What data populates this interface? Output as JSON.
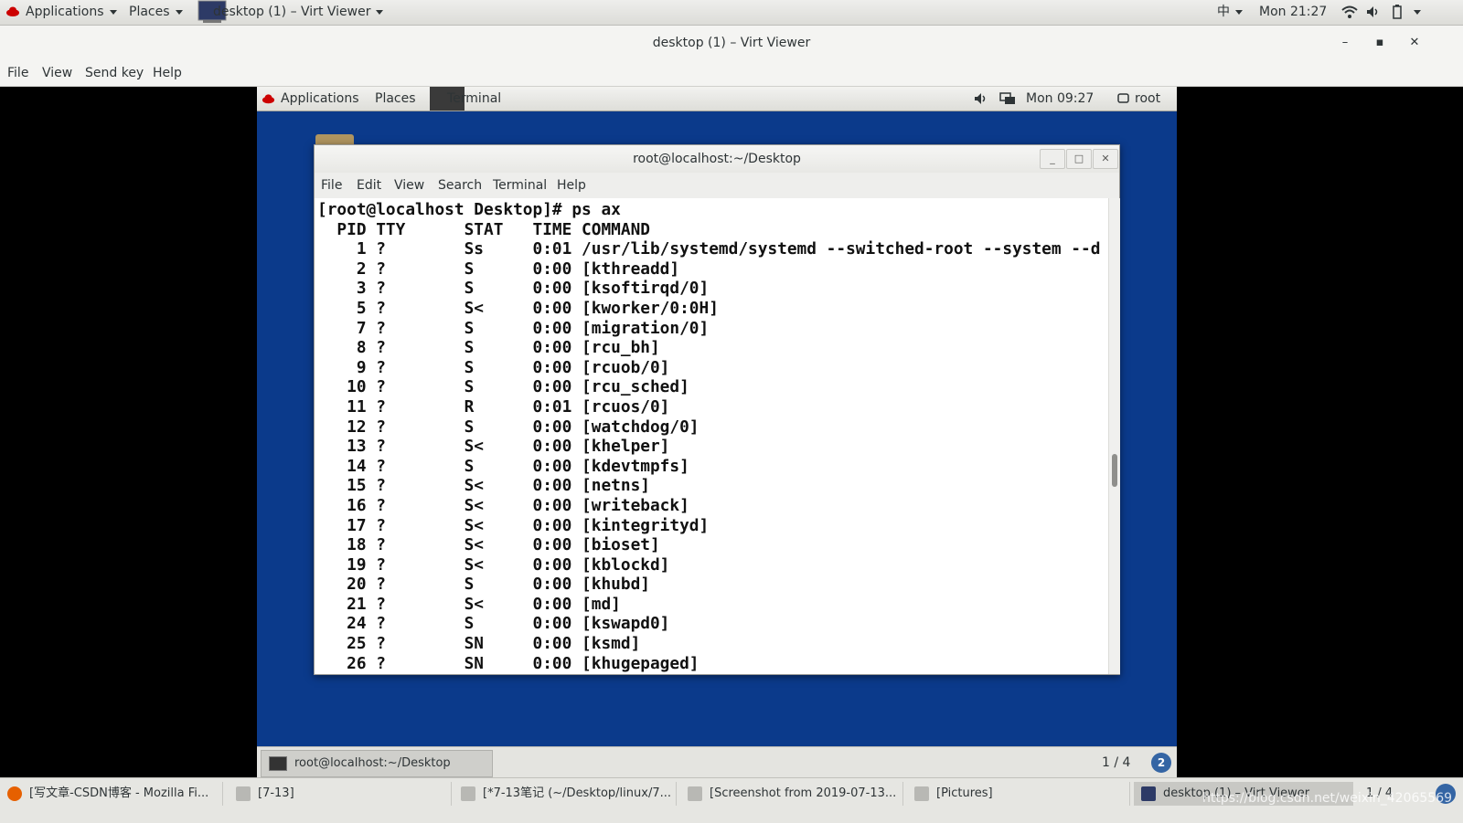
{
  "host_panel": {
    "applications": "Applications",
    "places": "Places",
    "window_title": "desktop (1) – Virt Viewer",
    "input_method": "中",
    "clock": "Mon 21:27"
  },
  "virt_viewer": {
    "title": "desktop (1) – Virt Viewer",
    "menu": [
      "File",
      "View",
      "Send key",
      "Help"
    ]
  },
  "guest_panel": {
    "applications": "Applications",
    "places": "Places",
    "terminal": "Terminal",
    "clock": "Mon 09:27",
    "user": "root"
  },
  "terminal": {
    "title": "root@localhost:~/Desktop",
    "menu": [
      "File",
      "Edit",
      "View",
      "Search",
      "Terminal",
      "Help"
    ],
    "output": "[root@localhost Desktop]# ps ax\n  PID TTY      STAT   TIME COMMAND\n    1 ?        Ss     0:01 /usr/lib/systemd/systemd --switched-root --system --d\n    2 ?        S      0:00 [kthreadd]\n    3 ?        S      0:00 [ksoftirqd/0]\n    5 ?        S<     0:00 [kworker/0:0H]\n    7 ?        S      0:00 [migration/0]\n    8 ?        S      0:00 [rcu_bh]\n    9 ?        S      0:00 [rcuob/0]\n   10 ?        S      0:00 [rcu_sched]\n   11 ?        R      0:01 [rcuos/0]\n   12 ?        S      0:00 [watchdog/0]\n   13 ?        S<     0:00 [khelper]\n   14 ?        S      0:00 [kdevtmpfs]\n   15 ?        S<     0:00 [netns]\n   16 ?        S<     0:00 [writeback]\n   17 ?        S<     0:00 [kintegrityd]\n   18 ?        S<     0:00 [bioset]\n   19 ?        S<     0:00 [kblockd]\n   20 ?        S      0:00 [khubd]\n   21 ?        S<     0:00 [md]\n   24 ?        S      0:00 [kswapd0]\n   25 ?        SN     0:00 [ksmd]\n   26 ?        SN     0:00 [khugepaged]"
  },
  "guest_taskbar": {
    "task": "root@localhost:~/Desktop",
    "pager": "1 / 4",
    "badge": "2"
  },
  "host_taskbar": {
    "tasks": [
      "[写文章-CSDN博客 - Mozilla Fi...",
      "[7-13]",
      "[*7-13笔记 (~/Desktop/linux/7...",
      "[Screenshot from 2019-07-13...",
      "[Pictures]",
      "desktop (1) – Virt Viewer"
    ],
    "pager": "1 / 4",
    "watermark": "https://blog.csdn.net/weixin_42065569"
  }
}
